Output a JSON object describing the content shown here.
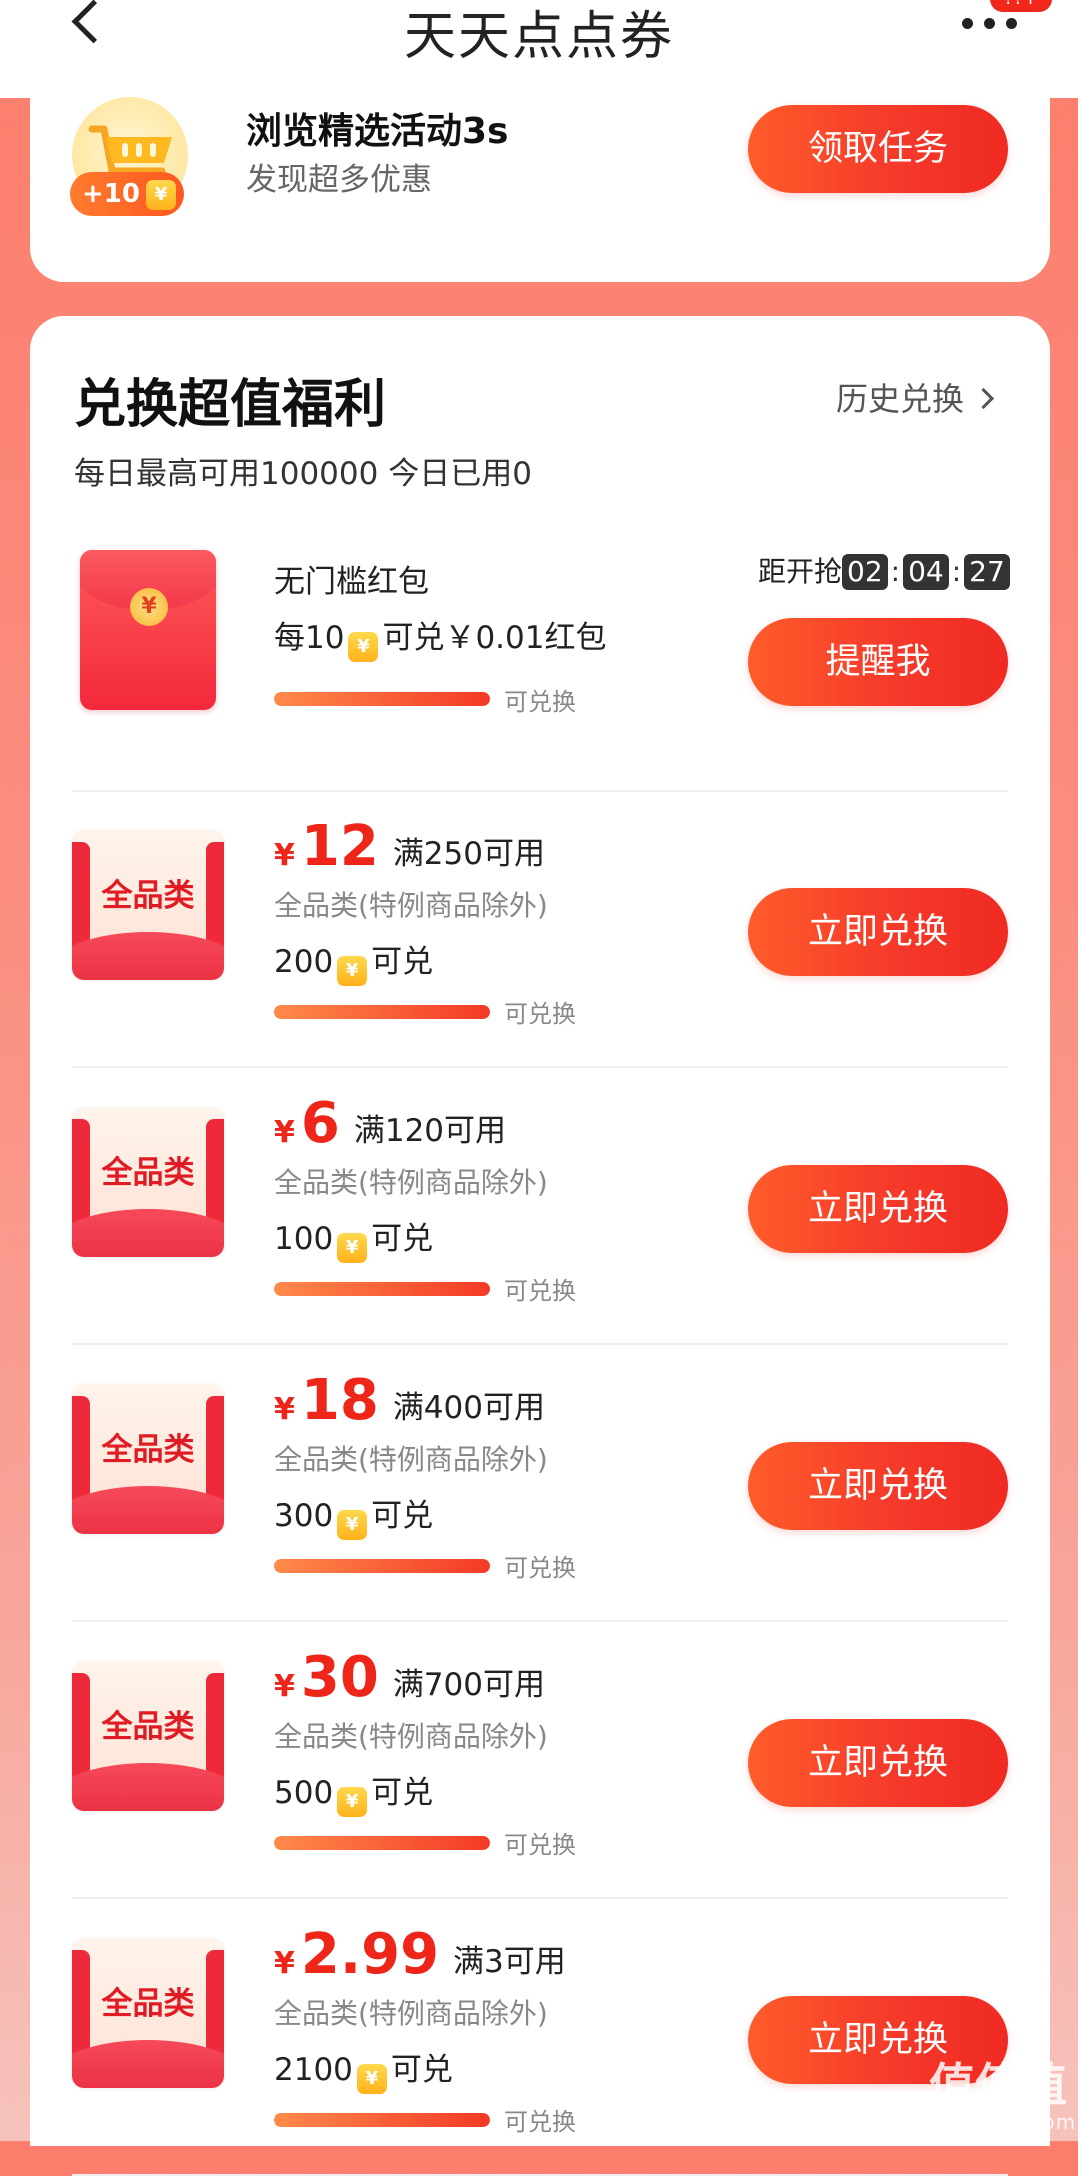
{
  "header": {
    "title": "天天点点券",
    "badge": "??+"
  },
  "task": {
    "title": "浏览精选活动3s",
    "subtitle": "发现超多优惠",
    "reward": "+10",
    "button": "领取任务"
  },
  "exchange": {
    "title": "兑换超值福利",
    "history": "历史兑换",
    "daily_limit": "每日最高可用100000 今日已用0"
  },
  "countdown": {
    "label": "距开抢",
    "hh": "02",
    "mm": "04",
    "ss": "27"
  },
  "redpacket": {
    "name": "无门槛红包",
    "rate_prefix": "每10",
    "rate_suffix": "可兑￥0.01红包",
    "progress_label": "可兑换",
    "progress": 1.0,
    "button": "提醒我"
  },
  "coupons": [
    {
      "yen": "¥",
      "amount": "12",
      "condition": "满250可用",
      "scope": "全品类(特例商品除外)",
      "cost": "200",
      "cost_suffix": "可兑",
      "tag": "全品类",
      "progress_label": "可兑换",
      "progress": 1.0,
      "button": "立即兑换"
    },
    {
      "yen": "¥",
      "amount": "6",
      "condition": "满120可用",
      "scope": "全品类(特例商品除外)",
      "cost": "100",
      "cost_suffix": "可兑",
      "tag": "全品类",
      "progress_label": "可兑换",
      "progress": 1.0,
      "button": "立即兑换"
    },
    {
      "yen": "¥",
      "amount": "18",
      "condition": "满400可用",
      "scope": "全品类(特例商品除外)",
      "cost": "300",
      "cost_suffix": "可兑",
      "tag": "全品类",
      "progress_label": "可兑换",
      "progress": 1.0,
      "button": "立即兑换"
    },
    {
      "yen": "¥",
      "amount": "30",
      "condition": "满700可用",
      "scope": "全品类(特例商品除外)",
      "cost": "500",
      "cost_suffix": "可兑",
      "tag": "全品类",
      "progress_label": "可兑换",
      "progress": 1.0,
      "button": "立即兑换"
    },
    {
      "yen": "¥",
      "amount": "2.99",
      "condition": "满3可用",
      "scope": "全品类(特例商品除外)",
      "cost": "2100",
      "cost_suffix": "可兑",
      "tag": "全品类",
      "progress_label": "可兑换",
      "progress": 1.0,
      "button": "立即兑换"
    }
  ],
  "watermark": {
    "big": "值值值",
    "small": "zhizhizhi.com"
  },
  "colors": {
    "accent": "#ee2519",
    "button_start": "#ff5c2a",
    "button_end": "#ef2a22",
    "background_top": "#fd7d6c",
    "coin": "#ffc42e"
  },
  "icons": [
    "back-icon",
    "more-icon",
    "shopping-basket-icon",
    "coin-icon",
    "chevron-right-icon",
    "red-envelope-icon"
  ]
}
